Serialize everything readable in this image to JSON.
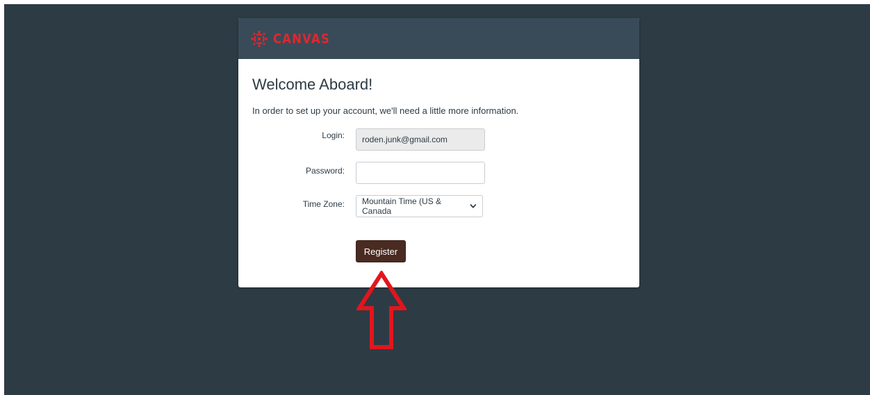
{
  "brand": {
    "name": "CANVAS",
    "logo_icon": "canvas-logo-icon",
    "color": "#e3262f"
  },
  "page": {
    "background": "#2d3b45",
    "header_background": "#394b58"
  },
  "form": {
    "title": "Welcome Aboard!",
    "intro": "In order to set up your account, we'll need a little more information.",
    "login": {
      "label": "Login:",
      "value": "roden.junk@gmail.com"
    },
    "password": {
      "label": "Password:",
      "value": ""
    },
    "timezone": {
      "label": "Time Zone:",
      "selected": "Mountain Time (US & Canada",
      "icon": "chevron-down-icon"
    },
    "register_label": "Register",
    "register_color": "#4a2b21"
  },
  "annotation": {
    "icon": "up-arrow-annotation-icon",
    "color": "#e3151d"
  }
}
